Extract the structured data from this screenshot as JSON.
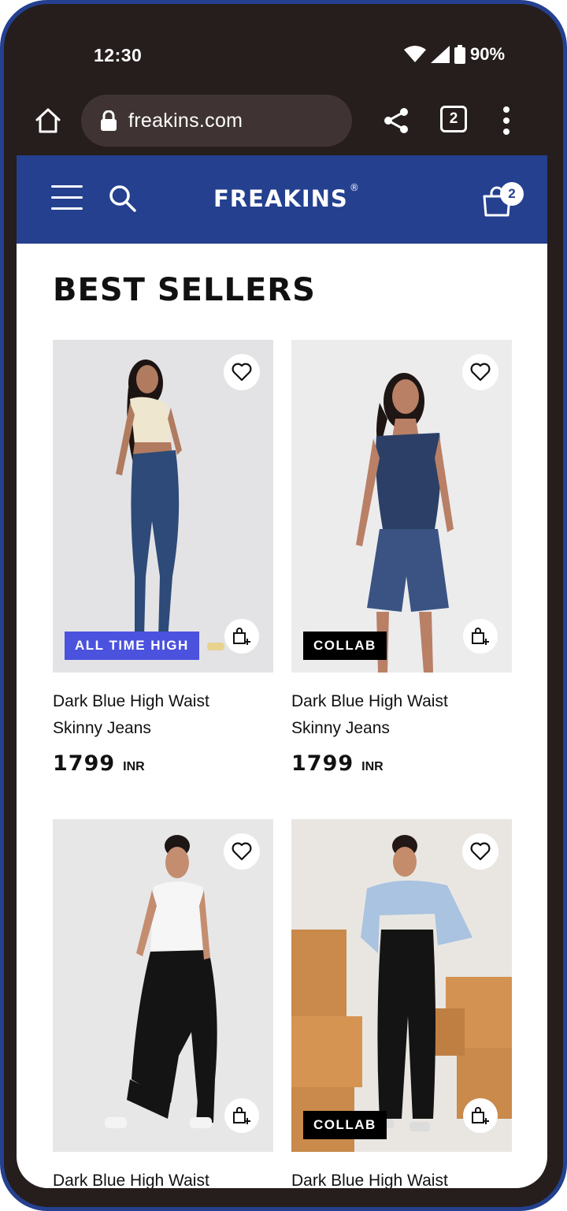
{
  "status_bar": {
    "time": "12:30",
    "battery": "90%"
  },
  "browser": {
    "url": "freakins.com",
    "tab_count": "2"
  },
  "site_header": {
    "logo": "FREAKINS",
    "logo_mark": "®",
    "cart_count": "2"
  },
  "section": {
    "title": "BEST SELLERS"
  },
  "products": [
    {
      "name": "Dark Blue High Waist Skinny Jeans",
      "price": "1799",
      "currency": "INR",
      "tag": "ALL TIME HIGH"
    },
    {
      "name": "Dark Blue High Waist Skinny Jeans",
      "price": "1799",
      "currency": "INR",
      "tag": "COLLAB"
    },
    {
      "name": "Dark Blue High Waist",
      "tag": ""
    },
    {
      "name": "Dark Blue High Waist",
      "tag": "COLLAB"
    }
  ],
  "colors": {
    "brand_blue": "#24408f",
    "tag_blue": "#4b52de",
    "tag_black": "#000000"
  },
  "icons": [
    "home-icon",
    "lock-icon",
    "share-icon",
    "tabs-icon",
    "more-vert-icon",
    "menu-icon",
    "search-icon",
    "cart-icon",
    "heart-icon",
    "add-to-bag-icon",
    "wifi-icon",
    "signal-icon",
    "battery-icon"
  ]
}
